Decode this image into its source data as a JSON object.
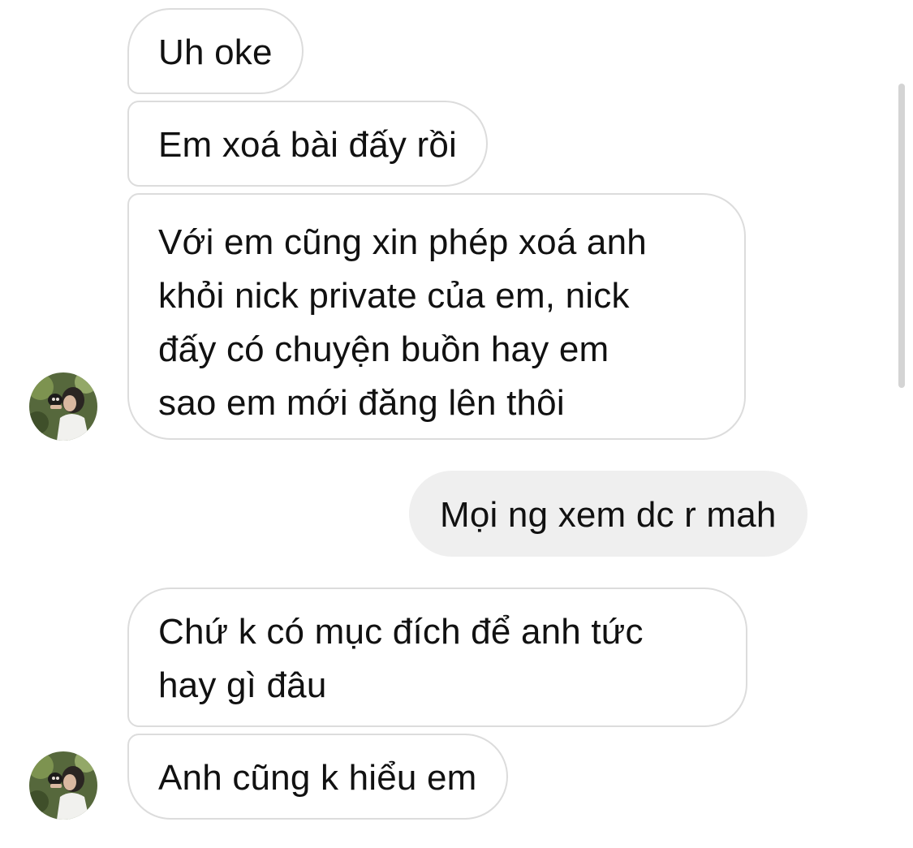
{
  "conversation": {
    "messages": [
      {
        "sender": "contact",
        "lines": [
          "Uh oke"
        ]
      },
      {
        "sender": "contact",
        "lines": [
          "Em xoá bài đấy rồi"
        ]
      },
      {
        "sender": "contact",
        "lines": [
          "Với em cũng xin phép xoá anh",
          "khỏi nick private của em, nick",
          "đấy có chuyện buồn hay em",
          "sao em mới đăng lên thôi"
        ]
      },
      {
        "sender": "me",
        "lines": [
          "Mọi ng xem dc r mah"
        ]
      },
      {
        "sender": "contact",
        "lines": [
          "Chứ k có mục đích để anh tức",
          "hay gì đâu"
        ]
      },
      {
        "sender": "contact",
        "lines": [
          "Anh cũng k hiểu em"
        ]
      }
    ]
  },
  "colors": {
    "incoming_border": "#dcdcdc",
    "outgoing_background": "#efefef",
    "text": "#111111"
  },
  "icons": {
    "avatar": "contact-avatar-photo"
  }
}
